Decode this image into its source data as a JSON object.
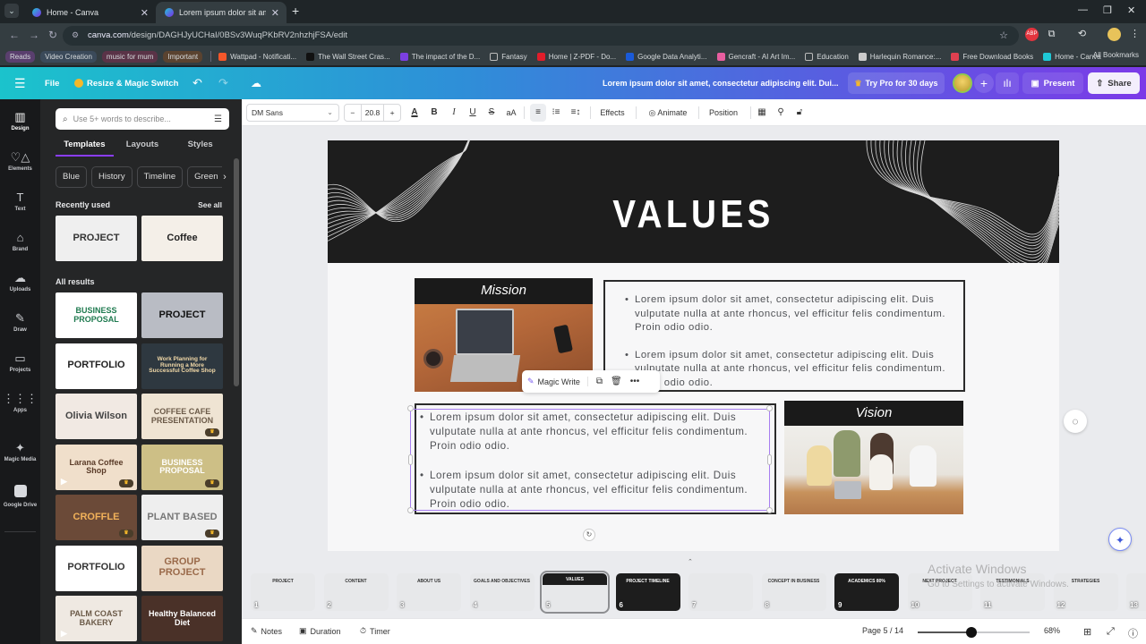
{
  "browser": {
    "tabs": [
      {
        "title": "Home - Canva",
        "active": false
      },
      {
        "title": "Lorem ipsum dolor sit amet, co",
        "active": true
      }
    ],
    "url_host": "canva.com",
    "url_path": "/design/DAGHJyUCHaI/0BSv3WuqPKbRV2nhzhjFSA/edit",
    "bookmarks_pills": [
      {
        "label": "Reads",
        "color": "#5a3f6e"
      },
      {
        "label": "Video Creation",
        "color": "#3b4a5a"
      },
      {
        "label": "music for mum",
        "color": "#5a3347"
      },
      {
        "label": "Important",
        "color": "#5a4330"
      }
    ],
    "bookmarks": [
      {
        "label": "Wattpad - Notificati...",
        "icon_color": "#f5572a"
      },
      {
        "label": "The Wall Street Cras...",
        "icon_color": "#111111"
      },
      {
        "label": "The impact of the D...",
        "icon_color": "#7b3fe0"
      },
      {
        "label": "Fantasy",
        "icon_color": "folder"
      },
      {
        "label": "Home | Z-PDF - Do...",
        "icon_color": "#e11d2a"
      },
      {
        "label": "Google Data Analyti...",
        "icon_color": "#1a5ad8"
      },
      {
        "label": "Gencraft - AI Art Im...",
        "icon_color": "#e85ea0"
      },
      {
        "label": "Education",
        "icon_color": "folder"
      },
      {
        "label": "Harlequin Romance:...",
        "icon_color": "#cccccc"
      },
      {
        "label": "Free Download Books",
        "icon_color": "#e04050"
      },
      {
        "label": "Home - Canva",
        "icon_color": "#1fc8d6"
      }
    ],
    "all_bookmarks": "All Bookmarks",
    "extension_badge": "ABP"
  },
  "header": {
    "file": "File",
    "resize": "Resize & Magic Switch",
    "doc_title": "Lorem ipsum dolor sit amet, consectetur adipiscing elit. Dui...",
    "try_pro": "Try Pro for 30 days",
    "present": "Present",
    "share": "Share"
  },
  "rail": [
    {
      "label": "Design",
      "icon": "▥",
      "active": true
    },
    {
      "label": "Elements",
      "icon": "♡△",
      "active": false
    },
    {
      "label": "Text",
      "icon": "T",
      "active": false
    },
    {
      "label": "Brand",
      "icon": "⌂",
      "active": false
    },
    {
      "label": "Uploads",
      "icon": "☁",
      "active": false
    },
    {
      "label": "Draw",
      "icon": "✎",
      "active": false
    },
    {
      "label": "Projects",
      "icon": "▭",
      "active": false
    },
    {
      "label": "Apps",
      "icon": "⋮⋮⋮",
      "active": false
    },
    {
      "label": "Magic Media",
      "icon": "✦",
      "active": false
    },
    {
      "label": "Google Drive",
      "icon": "",
      "active": false
    }
  ],
  "panel": {
    "search_placeholder": "Use 5+ words to describe...",
    "tabs": [
      "Templates",
      "Layouts",
      "Styles"
    ],
    "chips": [
      "Blue",
      "History",
      "Timeline",
      "Green"
    ],
    "recently_used": "Recently used",
    "see_all": "See all",
    "recent": [
      {
        "title": "PROJECT",
        "bg": "#efefef",
        "fg": "#333333"
      },
      {
        "title": "Coffee",
        "bg": "#f4efe8",
        "fg": "#222222"
      }
    ],
    "all_results": "All results",
    "results": [
      {
        "title": "BUSINESS PROPOSAL",
        "bg": "#ffffff",
        "fg": "#1e7a4f",
        "premium": false,
        "video": false
      },
      {
        "title": "PROJECT",
        "bg": "#b9bcc4",
        "fg": "#111111",
        "premium": false,
        "video": false
      },
      {
        "title": "PORTFOLIO",
        "bg": "#ffffff",
        "fg": "#222222",
        "premium": false,
        "video": false
      },
      {
        "title": "Work Planning for Running a More Successful Coffee Shop",
        "bg": "#2e3840",
        "fg": "#f2d9a8",
        "premium": false,
        "video": false
      },
      {
        "title": "Olivia Wilson",
        "bg": "#f1e9e3",
        "fg": "#444444",
        "premium": false,
        "video": false
      },
      {
        "title": "COFFEE CAFE PRESENTATION",
        "bg": "#efe4d3",
        "fg": "#6b5a48",
        "premium": true,
        "video": false
      },
      {
        "title": "Larana Coffee Shop",
        "bg": "#f0dfcb",
        "fg": "#5a3b28",
        "premium": true,
        "video": true
      },
      {
        "title": "BUSINESS PROPOSAL",
        "bg": "#cdbf86",
        "fg": "#ffffff",
        "premium": true,
        "video": false
      },
      {
        "title": "CROFFLE",
        "bg": "#6b4a38",
        "fg": "#f2b25a",
        "premium": true,
        "video": false
      },
      {
        "title": "PLANT BASED",
        "bg": "#eeeeee",
        "fg": "#777777",
        "premium": true,
        "video": false
      },
      {
        "title": "PORTFOLIO",
        "bg": "#ffffff",
        "fg": "#333333",
        "premium": false,
        "video": false
      },
      {
        "title": "GROUP PROJECT",
        "bg": "#ead8c4",
        "fg": "#9a6a4a",
        "premium": false,
        "video": false
      },
      {
        "title": "PALM COAST BAKERY",
        "bg": "#efe9e2",
        "fg": "#6b5a48",
        "premium": false,
        "video": true
      },
      {
        "title": "Healthy Balanced Diet",
        "bg": "#4a3128",
        "fg": "#ffffff",
        "premium": false,
        "video": false
      }
    ]
  },
  "toolbar": {
    "font": "DM Sans",
    "size_minus": "−",
    "font_size": "20.8",
    "size_plus": "+",
    "effects": "Effects",
    "animate": "Animate",
    "position": "Position"
  },
  "slide": {
    "title": "VALUES",
    "mission_label": "Mission",
    "vision_label": "Vision",
    "mission_bullets": [
      "Lorem ipsum dolor sit amet, consectetur adipiscing elit. Duis vulputate nulla at ante rhoncus, vel efficitur felis condimentum. Proin odio odio.",
      "Lorem ipsum dolor sit amet, consectetur adipiscing elit. Duis vulputate nulla at ante rhoncus, vel efficitur felis condimentum. Proin odio odio."
    ],
    "vision_bullets": [
      "Lorem ipsum dolor sit amet, consectetur adipiscing elit. Duis vulputate nulla at ante rhoncus, vel efficitur felis condimentum. Proin odio odio.",
      "Lorem ipsum dolor sit amet, consectetur adipiscing elit. Duis vulputate nulla at ante rhoncus, vel efficitur felis condimentum. Proin odio odio."
    ]
  },
  "context_menu": {
    "magic_write": "Magic Write"
  },
  "pages": [
    {
      "num": "1",
      "title": "PROJECT",
      "dark": false
    },
    {
      "num": "2",
      "title": "CONTENT",
      "dark": false
    },
    {
      "num": "3",
      "title": "ABOUT US",
      "dark": false
    },
    {
      "num": "4",
      "title": "GOALS AND OBJECTIVES",
      "dark": false
    },
    {
      "num": "5",
      "title": "VALUES",
      "dark": false,
      "active": true
    },
    {
      "num": "6",
      "title": "PROJECT TIMELINE",
      "dark": true
    },
    {
      "num": "7",
      "title": "",
      "dark": false
    },
    {
      "num": "8",
      "title": "CONCEPT IN BUSINESS",
      "dark": false
    },
    {
      "num": "9",
      "title": "ACADEMICS 80%",
      "dark": true
    },
    {
      "num": "10",
      "title": "NEXT PROJECT",
      "dark": false
    },
    {
      "num": "11",
      "title": "TESTIMONIALS",
      "dark": false
    },
    {
      "num": "12",
      "title": "STRATEGIES",
      "dark": false
    },
    {
      "num": "13",
      "title": "",
      "dark": false
    }
  ],
  "watermark": {
    "line1": "Activate Windows",
    "line2": "Go to Settings to activate Windows."
  },
  "footer": {
    "notes": "Notes",
    "duration": "Duration",
    "timer": "Timer",
    "page_indicator": "Page 5 / 14",
    "zoom_percent": "68%",
    "zoom_fraction": 0.48
  }
}
